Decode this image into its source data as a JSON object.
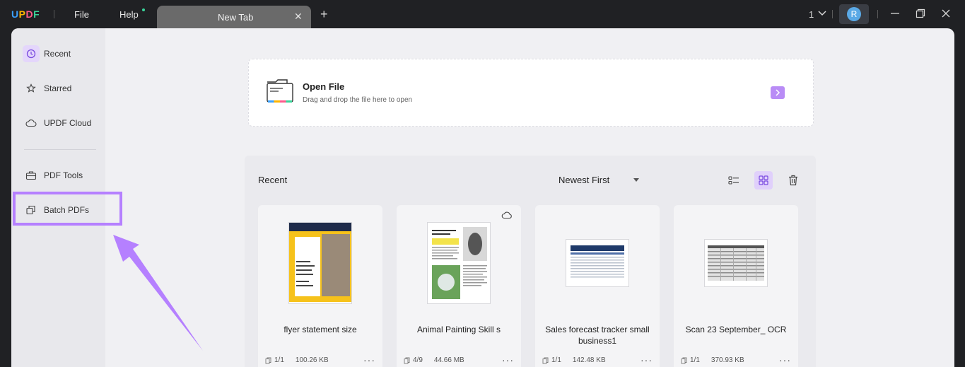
{
  "app": {
    "logo": {
      "U": "U",
      "P": "P",
      "D": "D",
      "F": "F"
    },
    "menu": {
      "file": "File",
      "help": "Help"
    },
    "tab": {
      "title": "New Tab",
      "close": "✕"
    },
    "new_tab": "+",
    "page_count": "1",
    "avatar_initial": "R"
  },
  "sidebar": {
    "items": [
      {
        "label": "Recent",
        "icon": "clock-icon"
      },
      {
        "label": "Starred",
        "icon": "star-icon"
      },
      {
        "label": "UPDF Cloud",
        "icon": "cloud-icon"
      },
      {
        "label": "PDF Tools",
        "icon": "toolbox-icon"
      },
      {
        "label": "Batch PDFs",
        "icon": "batch-icon"
      }
    ]
  },
  "open_file": {
    "title": "Open File",
    "subtitle": "Drag and drop the file here to open"
  },
  "recent": {
    "title": "Recent",
    "sort": "Newest First",
    "files": [
      {
        "name": "flyer statement size",
        "pages": "1/1",
        "size": "100.26 KB",
        "cloud": false
      },
      {
        "name": "Animal Painting Skill s",
        "pages": "4/9",
        "size": "44.66 MB",
        "cloud": true
      },
      {
        "name": "Sales forecast tracker small business1",
        "pages": "1/1",
        "size": "142.48 KB",
        "cloud": false
      },
      {
        "name": "Scan 23 September_ OCR",
        "pages": "1/1",
        "size": "370.93 KB",
        "cloud": false
      }
    ]
  },
  "colors": {
    "accent": "#b580ff",
    "titlebar": "#202124",
    "logo_u": "#3aa0ff",
    "logo_p": "#ffb400",
    "logo_d": "#ff5a8a",
    "logo_f": "#39d49a"
  }
}
